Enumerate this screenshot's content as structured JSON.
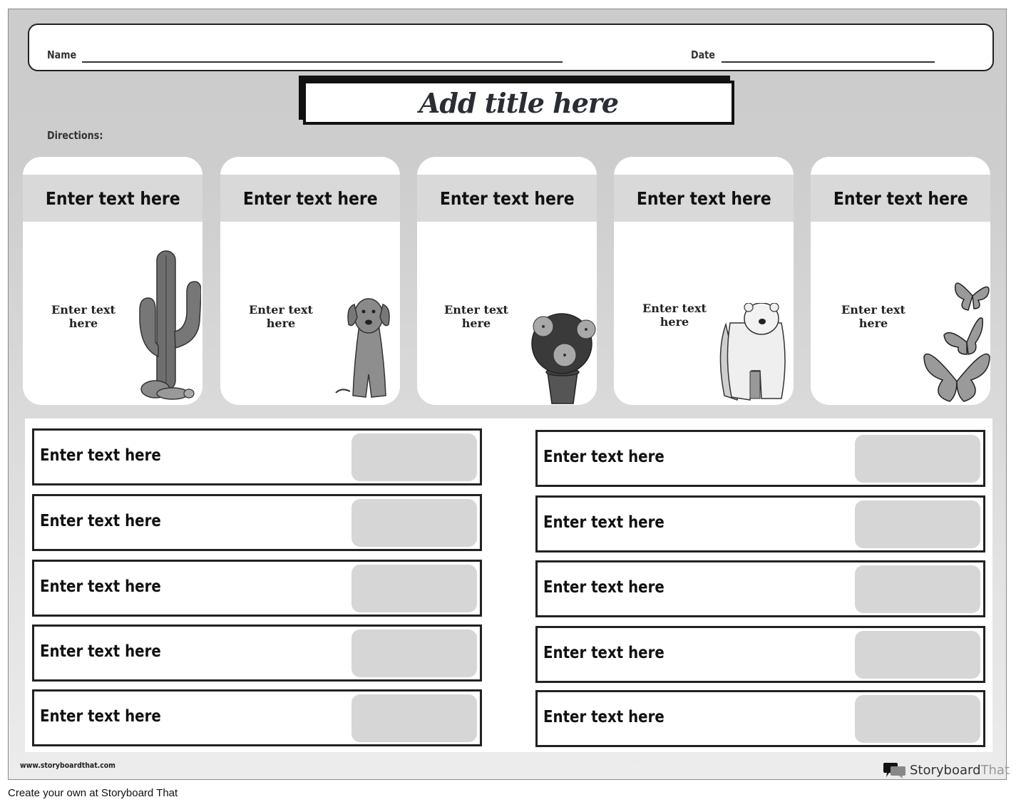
{
  "worksheet": {
    "name_label": "Name",
    "date_label": "Date",
    "title": "Add title here",
    "directions_label": "Directions:"
  },
  "cards": [
    {
      "header": "Enter text here",
      "body": "Enter text here",
      "image": "cactus"
    },
    {
      "header": "Enter text here",
      "body": "Enter text here",
      "image": "dog"
    },
    {
      "header": "Enter text here",
      "body": "Enter text here",
      "image": "flower-pot"
    },
    {
      "header": "Enter text here",
      "body": "Enter text here",
      "image": "polar-bear"
    },
    {
      "header": "Enter text here",
      "body": "Enter text here",
      "image": "butterflies"
    }
  ],
  "rows_left": [
    {
      "label": "Enter text here"
    },
    {
      "label": "Enter text here"
    },
    {
      "label": "Enter text here"
    },
    {
      "label": "Enter text here"
    },
    {
      "label": "Enter text here"
    }
  ],
  "rows_right": [
    {
      "label": "Enter text here"
    },
    {
      "label": "Enter text here"
    },
    {
      "label": "Enter text here"
    },
    {
      "label": "Enter text here"
    },
    {
      "label": "Enter text here"
    }
  ],
  "footer": {
    "url": "www.storyboardthat.com",
    "brand_primary": "Storyboard",
    "brand_secondary": "That",
    "create_own": "Create your own at Storyboard That"
  }
}
